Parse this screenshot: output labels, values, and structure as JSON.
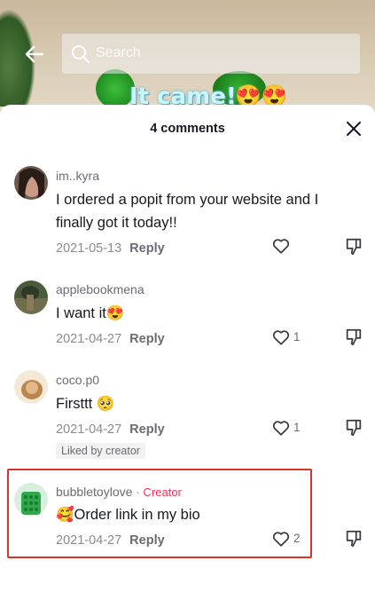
{
  "video": {
    "overlay_text": "It came!!",
    "overlay_emoji": "😍😍"
  },
  "topbar": {
    "back_icon": "arrow-left-icon",
    "search_placeholder": "Search",
    "search_icon": "search-icon"
  },
  "sheet": {
    "title": "4 comments",
    "close_icon": "close-icon"
  },
  "comments": [
    {
      "username": "im..kyra",
      "text": "I ordered a popit from your website and I finally got it today!!",
      "date": "2021-05-13",
      "reply_label": "Reply",
      "likes": ""
    },
    {
      "username": "applebookmena",
      "text": "I want it😍",
      "date": "2021-04-27",
      "reply_label": "Reply",
      "likes": "1"
    },
    {
      "username": "coco.p0",
      "text": "Firsttt 🥺",
      "date": "2021-04-27",
      "reply_label": "Reply",
      "likes": "1",
      "liked_by_creator": "Liked by creator"
    },
    {
      "username": "bubbletoylove",
      "dot": "·",
      "creator_label": "Creator",
      "text": "🥰Order link in my bio",
      "date": "2021-04-27",
      "reply_label": "Reply",
      "likes": "2"
    }
  ],
  "colors": {
    "creator_accent": "#fe2c55",
    "highlight_border": "#d9342b"
  }
}
